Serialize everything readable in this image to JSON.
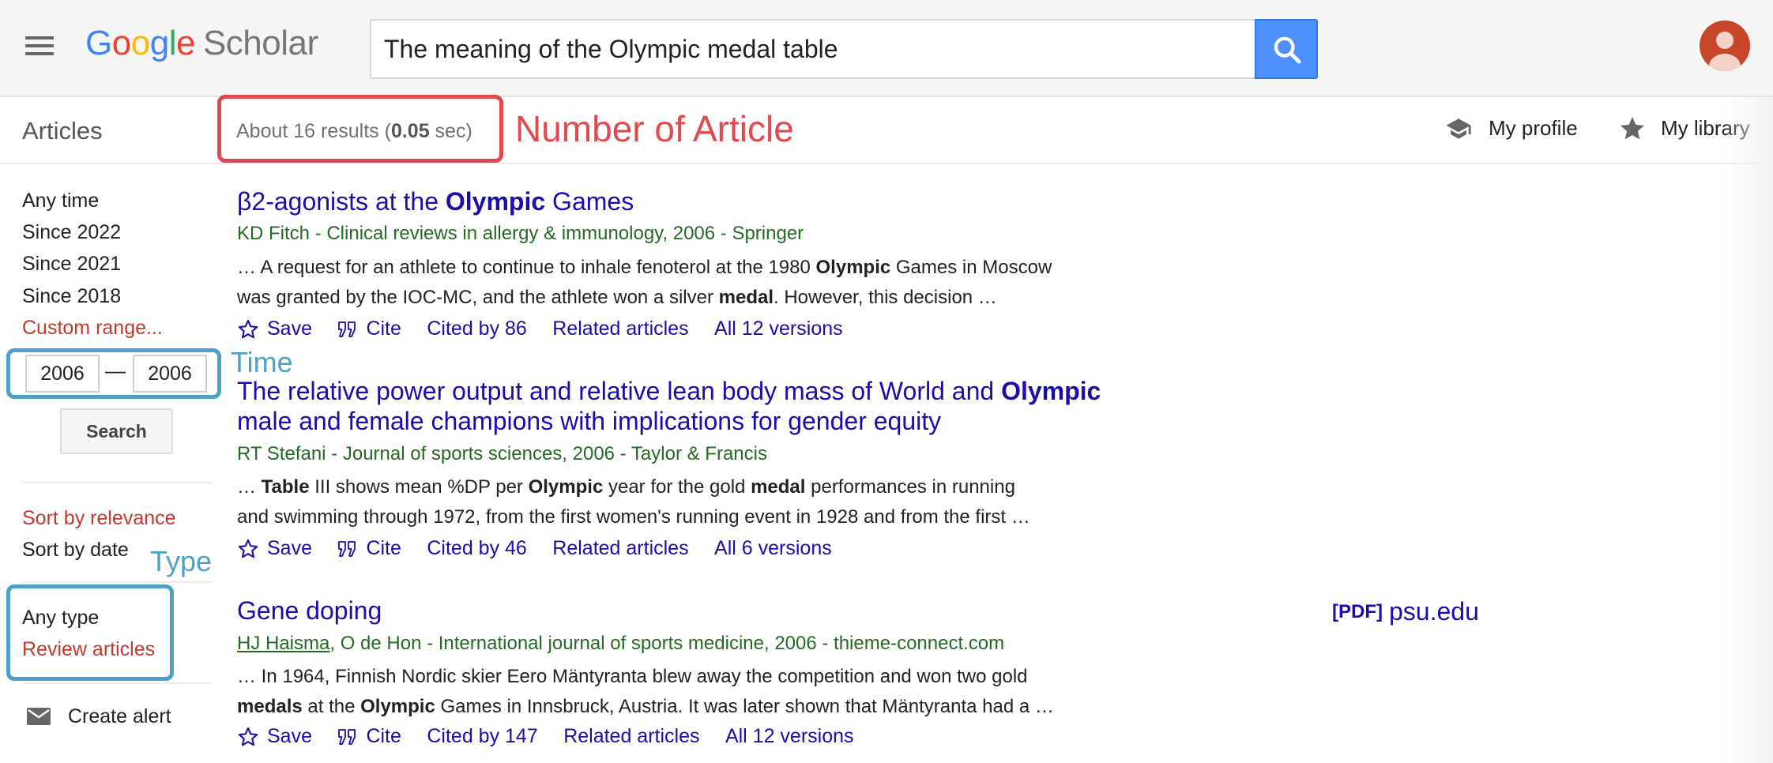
{
  "header": {
    "logo_google": [
      "G",
      "o",
      "o",
      "g",
      "l",
      "e"
    ],
    "logo_scholar": "Scholar",
    "search_value": "The meaning of the Olympic medal table",
    "icons": {
      "menu": "hamburger-icon",
      "search": "search-icon",
      "avatar": "user-avatar-icon"
    }
  },
  "subheader": {
    "section_label": "Articles",
    "results_prefix": "About 16 results (",
    "results_time": "0.05",
    "results_suffix": " sec)",
    "my_profile": "My profile",
    "my_library": "My library"
  },
  "annotations": {
    "number_of_article": "Number of Article",
    "time": "Time",
    "type": "Type",
    "colors": {
      "red": "#e04a4e",
      "blue": "#4ea0c8"
    }
  },
  "sidebar": {
    "time_filters": [
      "Any time",
      "Since 2022",
      "Since 2021",
      "Since 2018"
    ],
    "custom_range": "Custom range...",
    "year_from": "2006",
    "year_to": "2006",
    "range_dash": "—",
    "search_button": "Search",
    "sort_relevance": "Sort by relevance",
    "sort_date": "Sort by date",
    "any_type": "Any type",
    "review_articles": "Review articles",
    "create_alert": "Create alert"
  },
  "actions_labels": {
    "save": "Save",
    "cite": "Cite",
    "related": "Related articles"
  },
  "results": [
    {
      "title_pre": "β2-agonists at the ",
      "title_bold": "Olympic",
      "title_post": " Games",
      "meta": "KD Fitch - Clinical reviews in allergy & immunology, 2006 - Springer",
      "snippet1_a": "… A request for an athlete to continue to inhale fenoterol at the 1980 ",
      "snippet1_b": "Olympic",
      "snippet1_c": " Games in Moscow",
      "snippet2_a": "was granted by the IOC-MC, and the athlete won a silver ",
      "snippet2_b": "medal",
      "snippet2_c": ". However, this decision …",
      "cited_by": "Cited by 86",
      "versions": "All 12 versions"
    },
    {
      "title1_pre": "The relative power output and relative lean body mass of World and ",
      "title1_bold": "Olympic",
      "title2": "male and female champions with implications for gender equity",
      "meta": "RT Stefani - Journal of sports sciences, 2006 - Taylor & Francis",
      "snippet1_a": "… ",
      "snippet1_b": "Table",
      "snippet1_c": " III shows mean %DP per ",
      "snippet1_d": "Olympic",
      "snippet1_e": " year for the gold ",
      "snippet1_f": "medal",
      "snippet1_g": " performances in running",
      "snippet2": "and swimming through 1972, from the first women's running event in 1928 and from the first …",
      "cited_by": "Cited by 46",
      "versions": "All 6 versions"
    },
    {
      "title": "Gene doping",
      "meta_author": "HJ Haisma",
      "meta_rest": ", O de Hon - International journal of sports medicine, 2006 - thieme-connect.com",
      "snippet1": "… In 1964, Finnish Nordic skier Eero Mäntyranta blew away the competition and won two gold",
      "snippet2_a": "medals",
      "snippet2_b": " at the ",
      "snippet2_c": "Olympic",
      "snippet2_d": " Games in Innsbruck, Austria. It was later shown that Mäntyranta had a …",
      "cited_by": "Cited by 147",
      "versions": "All 12 versions",
      "pdf_tag": "[PDF]",
      "pdf_source": "psu.edu"
    }
  ]
}
